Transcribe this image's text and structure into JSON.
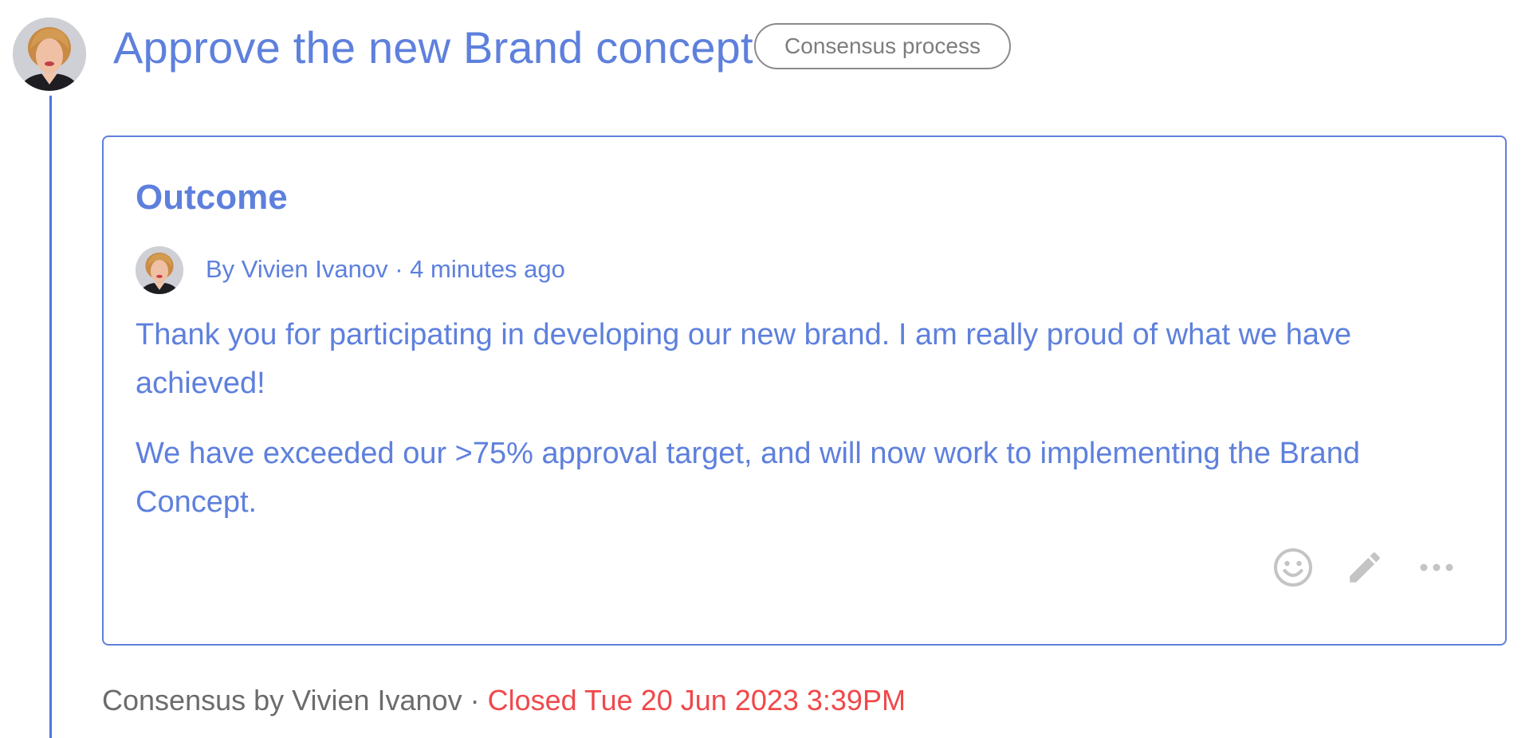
{
  "thread": {
    "title": "Approve the new Brand concept",
    "process_badge": "Consensus process"
  },
  "outcome": {
    "heading": "Outcome",
    "byline": "By Vivien Ivanov · 4 minutes ago",
    "paragraphs": [
      "Thank you for participating in developing our new brand. I am really proud of what we have achieved!",
      "We have exceeded our >75% approval target, and will now work to implementing the Brand Concept."
    ],
    "actions": [
      "emoji-reaction-icon",
      "edit-icon",
      "more-options-icon"
    ]
  },
  "footer": {
    "author_text": "Consensus by Vivien Ivanov · ",
    "status_text": "Closed Tue 20 Jun 2023 3:39PM"
  },
  "colors": {
    "accent": "#5e80dd",
    "thread_line": "#4f78d6",
    "closed_status": "#f0484b",
    "muted_text": "#6b6b6b",
    "icon_gray": "#c4c4c4"
  }
}
